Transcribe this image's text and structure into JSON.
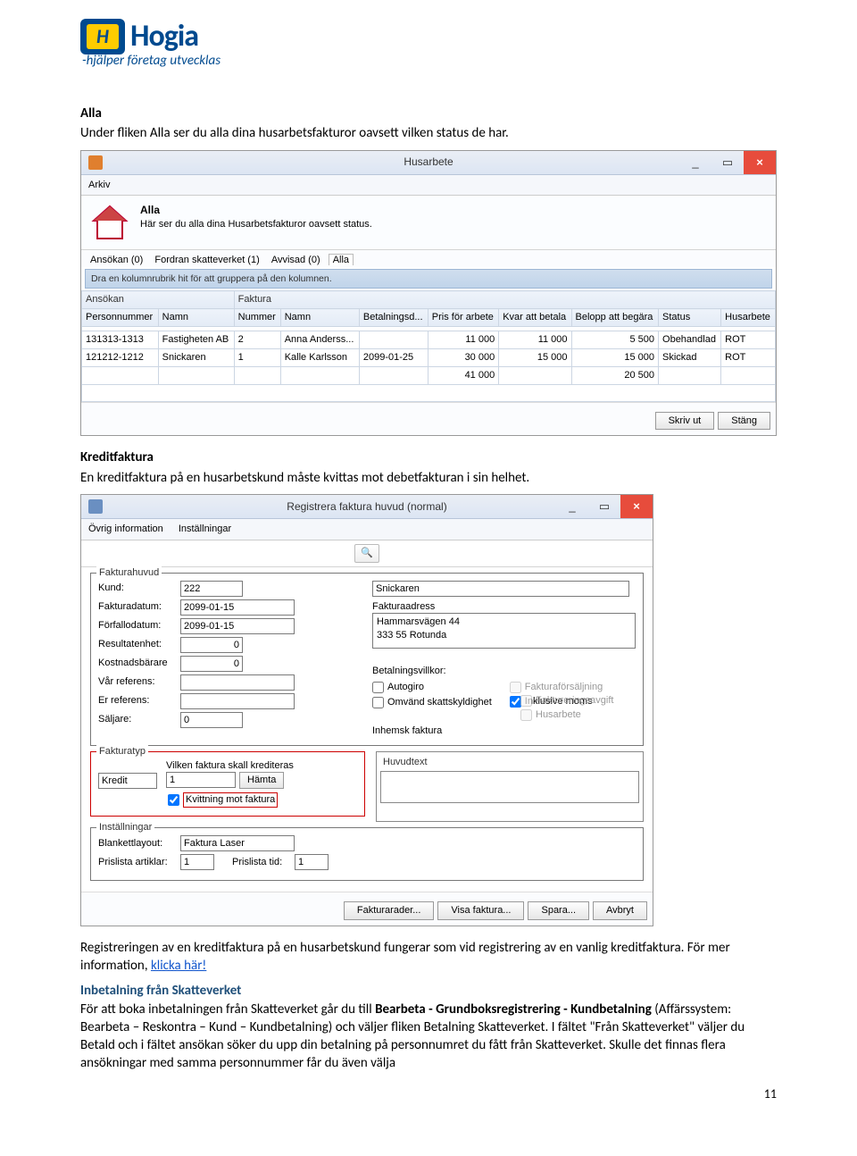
{
  "logo": {
    "brand": "Hogia",
    "tagline": "-hjälper företag utvecklas",
    "mark": "H"
  },
  "section_alla": {
    "title": "Alla",
    "desc": "Under fliken Alla ser du alla dina husarbetsfakturor oavsett vilken status de har."
  },
  "win1": {
    "title": "Husarbete",
    "menu": "Arkiv",
    "minimize": "_",
    "restore": "▭",
    "close": "×",
    "header_title": "Alla",
    "header_sub": "Här ser du alla dina Husarbetsfakturor oavsett status.",
    "tabs": [
      "Ansökan (0)",
      "Fordran skatteverket (1)",
      "Avvisad (0)",
      "Alla"
    ],
    "groupbar": "Dra en kolumnrubrik hit för att gruppera på den kolumnen.",
    "category_row": {
      "ansokan": "Ansökan",
      "faktura": "Faktura"
    },
    "cols": [
      "Personnummer",
      "Namn",
      "Nummer",
      "Namn",
      "Betalningsd...",
      "Pris för arbete",
      "Kvar att betala",
      "Belopp att begära",
      "Status",
      "Husarbete"
    ],
    "rows": [
      {
        "pnr": "131313-1313",
        "aname": "Fastigheten AB",
        "num": "2",
        "fname": "Anna Anderss...",
        "date": "",
        "pris": "11 000",
        "kvar": "11 000",
        "belopp": "5 500",
        "status": "Obehandlad",
        "hus": "ROT"
      },
      {
        "pnr": "121212-1212",
        "aname": "Snickaren",
        "num": "1",
        "fname": "Kalle Karlsson",
        "date": "2099-01-25",
        "pris": "30 000",
        "kvar": "15 000",
        "belopp": "15 000",
        "status": "Skickad",
        "hus": "ROT"
      }
    ],
    "totals": {
      "pris": "41 000",
      "belopp": "20 500"
    },
    "btn_print": "Skriv ut",
    "btn_close": "Stäng"
  },
  "section_kredit": {
    "title": "Kreditfaktura",
    "desc": "En kreditfaktura på en husarbetskund måste kvittas mot debetfakturan i sin helhet."
  },
  "win2": {
    "title": "Registrera faktura huvud (normal)",
    "minimize": "_",
    "restore": "▭",
    "close": "×",
    "menu1": "Övrig information",
    "menu2": "Inställningar",
    "search_icon": "🔍",
    "fh": {
      "legend": "Fakturahuvud",
      "kund_lab": "Kund:",
      "kund_val": "222",
      "kund_name": "Snickaren",
      "fakturadatum_lab": "Fakturadatum:",
      "fakturadatum_val": "2099-01-15",
      "forfallo_lab": "Förfallodatum:",
      "forfallo_val": "2099-01-15",
      "resultatenhet_lab": "Resultatenhet:",
      "resultatenhet_val": "0",
      "kostnadsbare_lab": "Kostnadsbärare",
      "kostnadsbare_val": "0",
      "varreferens_lab": "Vår referens:",
      "erreferens_lab": "Er referens:",
      "saljare_lab": "Säljare:",
      "saljare_val": "0",
      "fakturaadress_lab": "Fakturaadress",
      "addr_line1": "Hammarsvägen 44",
      "addr_line2": "333 55 Rotunda",
      "betalningsvillkor_lab": "Betalningsvillkor:",
      "chk_autogiro": "Autogiro",
      "chk_inkmoms": "Inklusive moms",
      "chk_fakturaforsaljning": "Fakturaförsäljning",
      "chk_faktureringsavgift": "Faktureringsavgift",
      "chk_omvand": "Omvänd skattskyldighet",
      "chk_husarbete": "Husarbete",
      "inhemsk_lab": "Inhemsk faktura"
    },
    "ft": {
      "legend": "Fakturatyp",
      "typ_val": "Kredit",
      "vilken_lab": "Vilken faktura skall krediteras",
      "vilken_val": "1",
      "hamta_btn": "Hämta",
      "kvittning_chk": "Kvittning mot faktura"
    },
    "hv": {
      "legend": "Huvudtext"
    },
    "inst": {
      "legend": "Inställningar",
      "blankett_lab": "Blankettlayout:",
      "blankett_val": "Faktura Laser",
      "prisartiklar_lab": "Prislista artiklar:",
      "prisartiklar_val": "1",
      "pristid_lab": "Prislista tid:",
      "pristid_val": "1"
    },
    "btn_fakturarader": "Fakturarader...",
    "btn_visa": "Visa faktura...",
    "btn_spara": "Spara...",
    "btn_avbryt": "Avbryt"
  },
  "para_reg": {
    "text": "Registreringen av en kreditfaktura på en husarbetskund fungerar som vid registrering av en vanlig kreditfaktura. För mer information, ",
    "link": "klicka här!"
  },
  "section_inbet": {
    "title": "Inbetalning från Skatteverket",
    "p1a": "För att boka inbetalningen från Skatteverket går du till ",
    "p1b": "Bearbeta - Grundboksregistrering - Kundbetalning",
    "p1c": " (Affärssystem: Bearbeta – Reskontra – Kund – Kundbetalning) och väljer fliken Betalning Skatteverket. I fältet \"Från Skatteverket\" väljer du Betald och i fältet ansökan söker du upp din betalning på personnumret du fått från Skatteverket. Skulle det finnas flera ansökningar med samma personnummer får du även välja"
  },
  "page_number": "11"
}
